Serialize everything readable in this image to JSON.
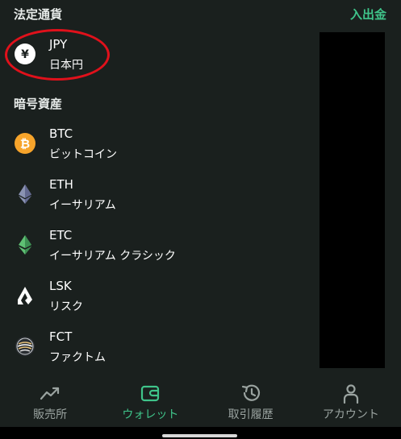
{
  "fiat": {
    "header": "法定通貨",
    "deposit_label": "入出金",
    "items": [
      {
        "code": "JPY",
        "name": "日本円",
        "icon": "yen-icon"
      }
    ]
  },
  "crypto": {
    "header": "暗号資産",
    "items": [
      {
        "code": "BTC",
        "name": "ビットコイン",
        "icon": "bitcoin-icon"
      },
      {
        "code": "ETH",
        "name": "イーサリアム",
        "icon": "ethereum-icon"
      },
      {
        "code": "ETC",
        "name": "イーサリアム クラシック",
        "icon": "ethereum-classic-icon"
      },
      {
        "code": "LSK",
        "name": "リスク",
        "icon": "lisk-icon"
      },
      {
        "code": "FCT",
        "name": "ファクトム",
        "icon": "factom-icon"
      }
    ]
  },
  "nav": {
    "items": [
      {
        "label": "販売所",
        "icon": "trend-chart-icon",
        "active": false
      },
      {
        "label": "ウォレット",
        "icon": "wallet-icon",
        "active": true
      },
      {
        "label": "取引履歴",
        "icon": "history-icon",
        "active": false
      },
      {
        "label": "アカウント",
        "icon": "person-icon",
        "active": false
      }
    ]
  },
  "colors": {
    "background": "#1a201e",
    "accent": "#3fc48a",
    "highlight": "#e0111b",
    "bitcoin": "#f7a42b",
    "nav_inactive": "#9aa3a0"
  }
}
